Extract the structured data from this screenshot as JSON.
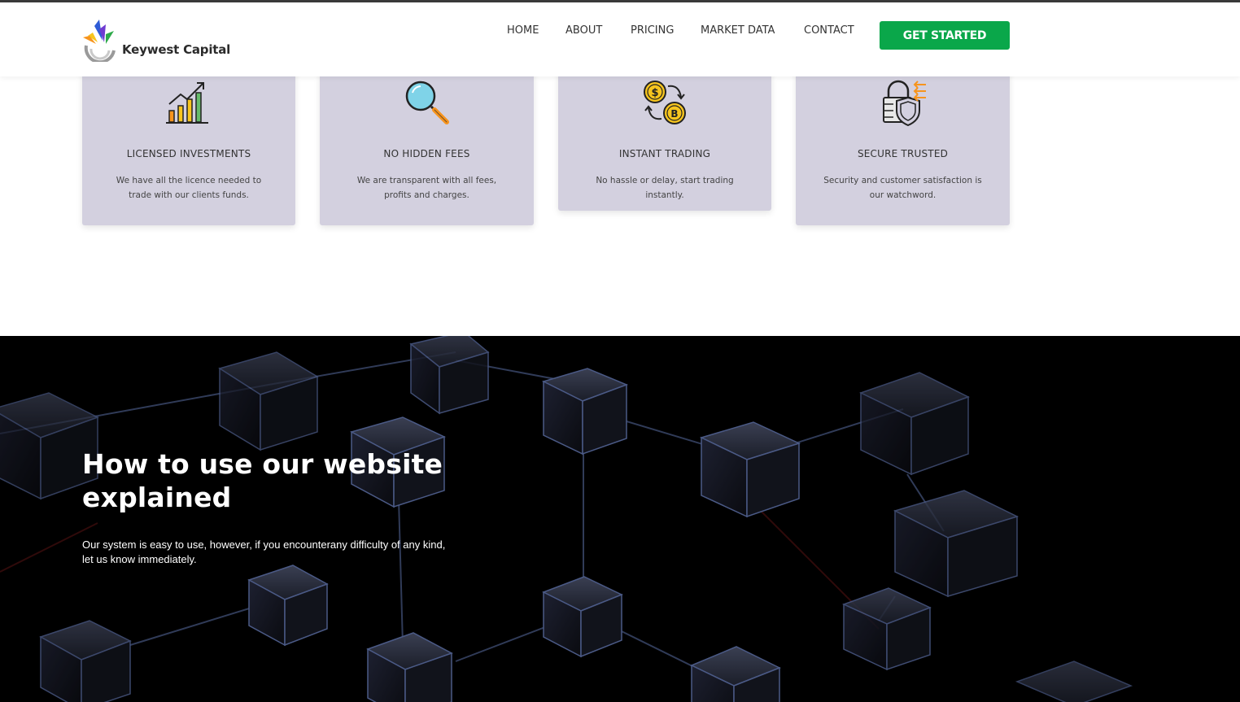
{
  "brand": {
    "name": "Keywest Capital",
    "accent_color": "#0aa74a",
    "card_bg_color": "#d3d0df"
  },
  "nav": {
    "items": [
      {
        "label": "HOME"
      },
      {
        "label": "ABOUT"
      },
      {
        "label": "PRICING"
      },
      {
        "label": "MARKET DATA"
      },
      {
        "label": "CONTACT"
      }
    ],
    "cta_label": "GET STARTED"
  },
  "features": [
    {
      "icon": "growth-chart-icon",
      "title": "LICENSED INVESTMENTS",
      "text": "We have all the licence needed to trade with our clients funds."
    },
    {
      "icon": "magnifier-icon",
      "title": "NO HIDDEN FEES",
      "text": "We are transparent with all fees, profits and charges."
    },
    {
      "icon": "crypto-exchange-icon",
      "title": "INSTANT TRADING",
      "text": "No hassle or delay, start trading instantly."
    },
    {
      "icon": "secure-shield-lock-icon",
      "title": "SECURE TRUSTED",
      "text": "Security and customer satisfaction is our watchword."
    }
  ],
  "hero": {
    "title": "How to use our website explained",
    "text": "Our system is easy to use, however, if you encounterany difficulty of any kind, let us know immediately."
  }
}
